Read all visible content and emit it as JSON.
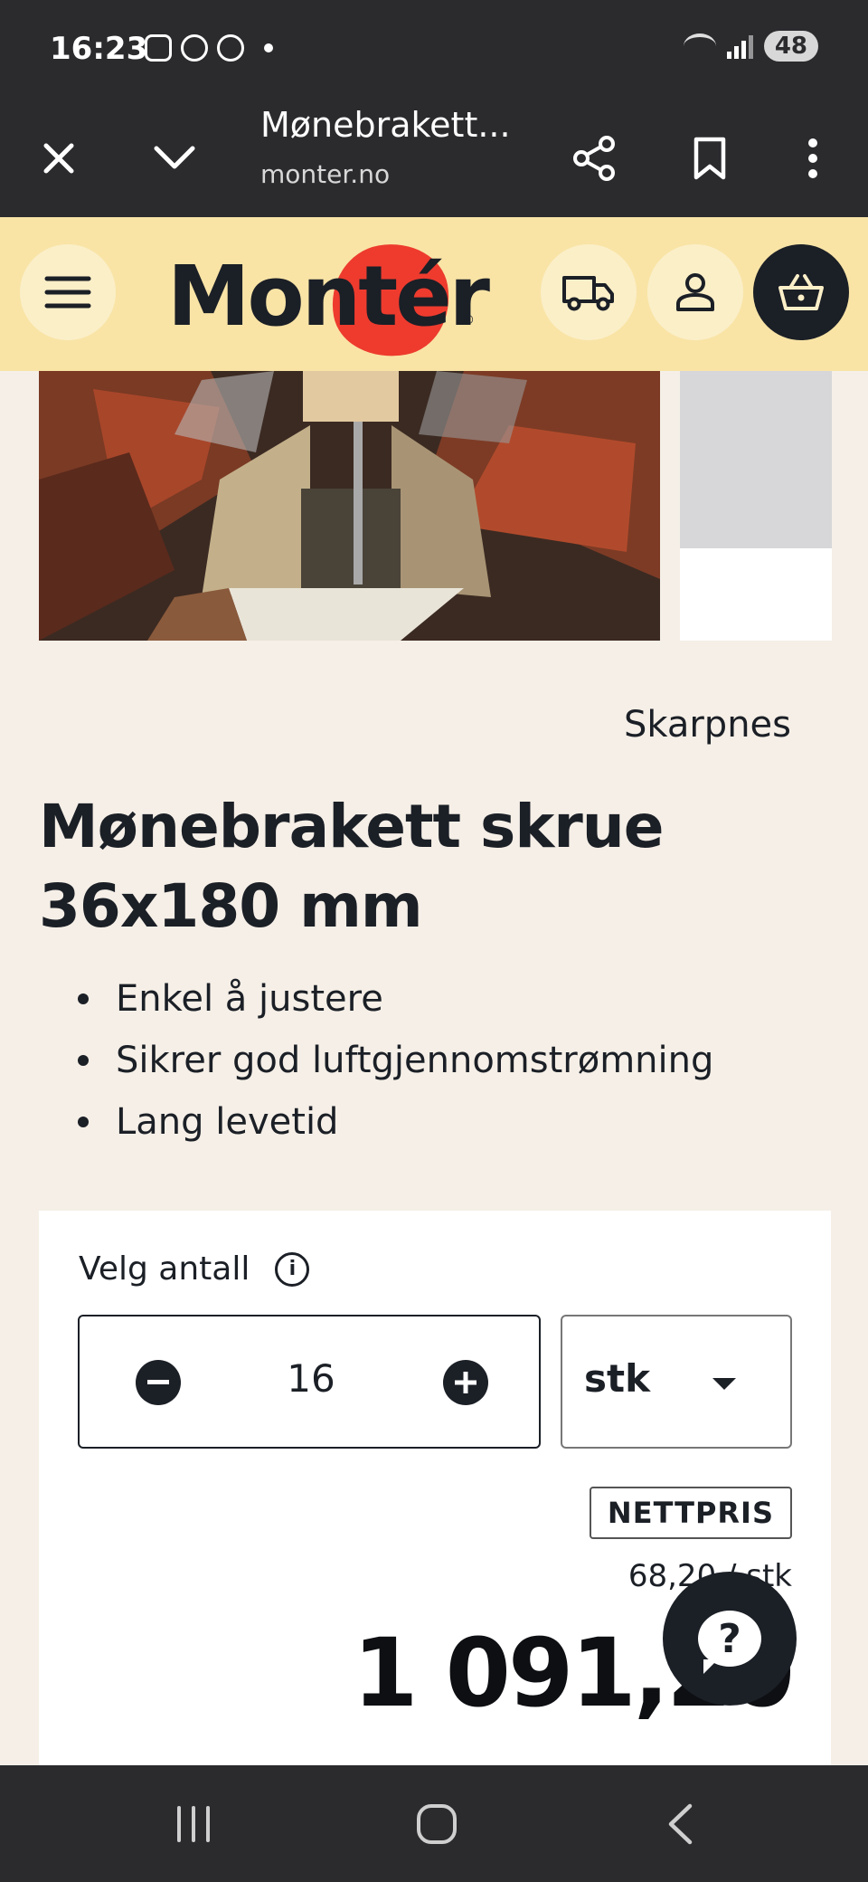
{
  "status_bar": {
    "time": "16:23",
    "battery": "48",
    "notification_icons": [
      "instagram-icon",
      "tiktok-icon",
      "chrome-icon"
    ]
  },
  "browser": {
    "page_title": "Mønebrakett...",
    "url": "monter.no"
  },
  "site": {
    "logo_text": "Montér",
    "logo_color": "#ee3b2e",
    "header_color": "#f9e4a6"
  },
  "product": {
    "brand": "Skarpnes",
    "title": "Mønebrakett skrue 36x180 mm",
    "features": [
      "Enkel å justere",
      "Sikrer god luftgjennomstrømning",
      "Lang levetid"
    ]
  },
  "purchase": {
    "quantity_label": "Velg antall",
    "quantity": "16",
    "unit": "stk",
    "price_badge": "NETTPRIS",
    "unit_price": "68,20 / stk",
    "total_price": "1 091,20"
  }
}
